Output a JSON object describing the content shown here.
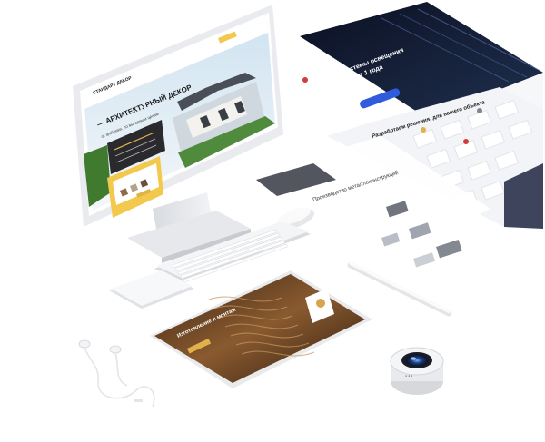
{
  "monitor": {
    "brand": "СТАНДАРТ ДЕКОР",
    "headline": "— АРХИТЕКТУРНЫЙ ДЕКОР",
    "subline": "от фабрики, по выгодным ценам"
  },
  "right_site": {
    "hero_title_line1": "Создаём системы освещения",
    "hero_title_line2": "с поставкой от 1 года",
    "section_title": "Разработаем решения, для вашего объекта",
    "cta": "Получить консультацию"
  },
  "mid_site": {
    "title": "Производство металлоконструкций"
  },
  "tablet": {
    "headline": "Изготовление и монтаж"
  },
  "colors": {
    "accent_blue": "#2f5bdc",
    "accent_red": "#d23a3a",
    "gold": "#e0b24a",
    "dark_navy": "#141a2e"
  }
}
